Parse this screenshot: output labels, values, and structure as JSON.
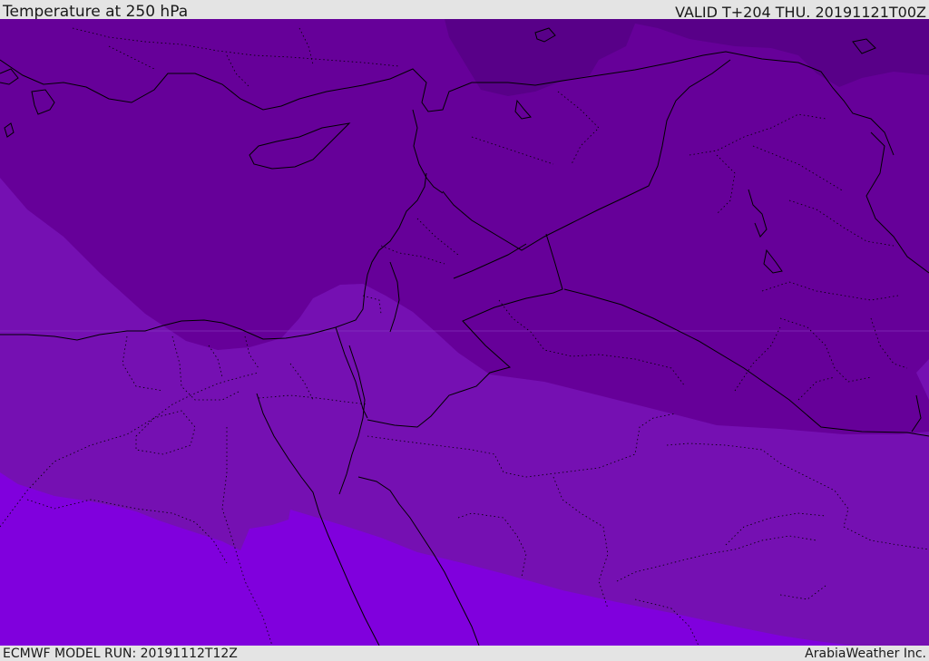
{
  "header": {
    "title": "Temperature at 250 hPa",
    "valid_time": "VALID T+204 THU. 20191121T00Z"
  },
  "footer": {
    "model_run": "ECMWF MODEL RUN: 20191112T12Z",
    "credit": "ArabiaWeather Inc."
  },
  "map": {
    "field": "temperature",
    "level_hpa": 250,
    "region": "Eastern Mediterranean / Middle East",
    "shading_colors": {
      "coldest": "#520080",
      "colder": "#660099",
      "mid": "#7510b2",
      "warmer": "#8000dd"
    },
    "border_color": "#000000"
  }
}
